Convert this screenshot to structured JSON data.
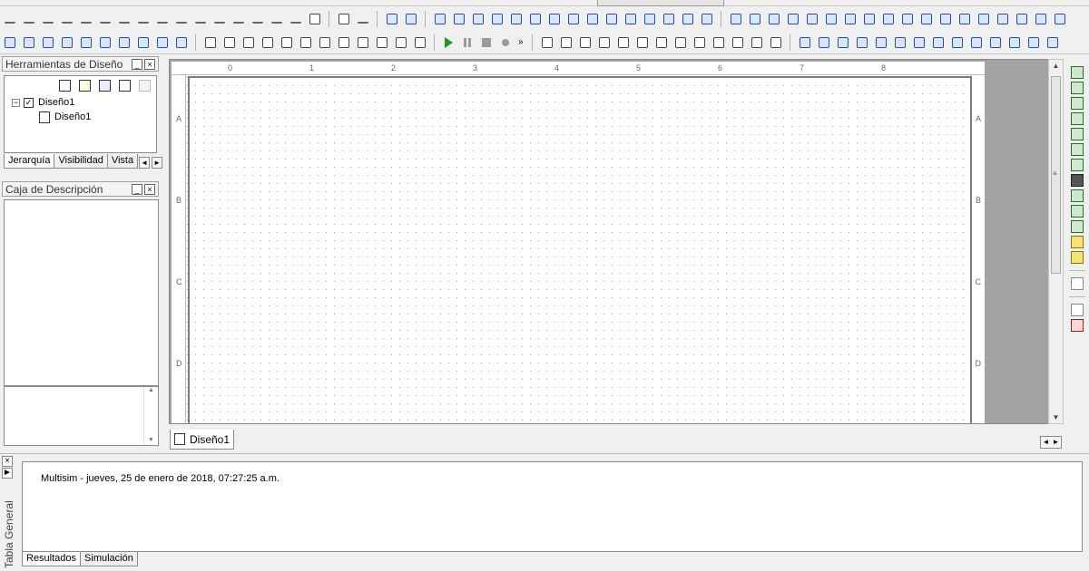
{
  "panels": {
    "design_tools": {
      "title": "Herramientas de Diseño",
      "tree_root": "Diseño1",
      "tree_child": "Diseño1",
      "tabs": [
        "Jerarquía",
        "Visibilidad",
        "Vista"
      ]
    },
    "description": {
      "title": "Caja de Descripción"
    }
  },
  "workspace": {
    "ruler_top": [
      "0",
      "1",
      "2",
      "3",
      "4",
      "5",
      "6",
      "7",
      "8"
    ],
    "ruler_side": [
      "A",
      "B",
      "C",
      "D"
    ],
    "sheet_tab": "Diseño1"
  },
  "output": {
    "side_label": "Tabla General",
    "message": "Multisim  -  jueves, 25 de enero de 2018, 07:27:25 a.m.",
    "tabs": [
      "Resultados",
      "Simulación"
    ]
  },
  "controls": {
    "close": "×",
    "minimize": "_",
    "more": "»",
    "scroll_up": "▲",
    "scroll_down": "▼",
    "scroll_left": "◄",
    "scroll_right": "►",
    "tree_collapse": "−",
    "tree_check": "✓",
    "grip": "≡"
  },
  "icons": [
    "play-icon",
    "pause-icon",
    "stop-icon",
    "record-icon",
    "new-file-icon",
    "open-folder-icon",
    "save-icon",
    "design-icon",
    "multimeter-icon",
    "oscilloscope-icon",
    "probe-icon"
  ]
}
